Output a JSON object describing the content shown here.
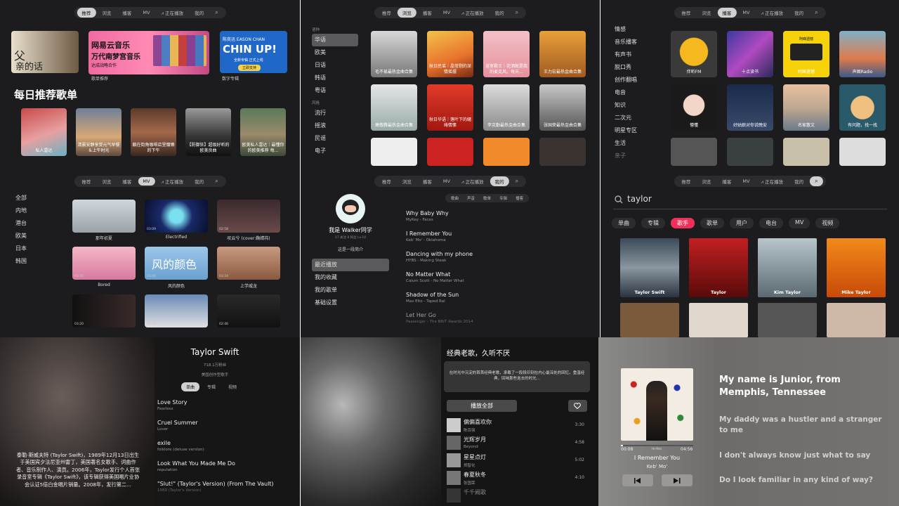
{
  "nav": {
    "rec": "推荐",
    "browse": "浏览",
    "podcast": "播客",
    "mv": "MV",
    "playing": "⩘ 正在播放",
    "mine": "我的",
    "search": "⌕"
  },
  "p1": {
    "banner1_l1": "父",
    "banner1_l2": "亲的话",
    "banner2_title": "网易云音乐",
    "banner2_sub": "万代南梦宫音乐",
    "banner2_sub2": "达成战略合作",
    "banner2_tag": "歌单推荐",
    "banner3_t1": "陈奕迅 EASON CHAN",
    "banner3_big": "CHIN UP!",
    "banner3_t2": "全新专辑 正式上线",
    "banner3_btn": "立即支持",
    "banner3_tag": "数字专辑",
    "section": "每日推荐歌单",
    "tiles": [
      "私人雷达",
      "清晨安静享受元气早餐＆上午时光",
      "躺在街角咖啡店里慵懒的下午",
      "【防御狂】超级好听的欧美良曲",
      "欧美私人雷达｜最懂你的欧美推荐 每..."
    ]
  },
  "p2": {
    "h1": "语种",
    "langs": [
      "华语",
      "欧美",
      "日语",
      "韩语",
      "粤语"
    ],
    "h2": "风格",
    "styles": [
      "流行",
      "摇滚",
      "民谣",
      "电子"
    ],
    "tiles": [
      "毛不易最热金曲合集",
      "秋日民谣｜晶莹剔的深情摇摆",
      "浴室歌王｜花洒就是我的麦克风，每天...",
      "王力宏最热金曲合集",
      "萧敬腾最热金曲合集",
      "秋日华语｜落叶下的缱绻情愫",
      "李克勤最热金曲合集",
      "张国荣最热金曲合集"
    ]
  },
  "p3": {
    "cats": [
      "情感",
      "音乐播客",
      "有声书",
      "脱口秀",
      "创作翻唱",
      "电音",
      "知识",
      "二次元",
      "明星专区",
      "生活",
      "亲子"
    ],
    "tiles": [
      "伴听FM",
      "十点读书",
      "阿峰遗憾",
      "声图Radio",
      "懵懂",
      "好姑娘对你说晚安",
      "名家散文",
      "有问题，找一找"
    ],
    "t3_tag": "阿峰遗憾"
  },
  "p4": {
    "regions": [
      "全部",
      "内地",
      "港台",
      "欧美",
      "日本",
      "韩国"
    ],
    "tiles": [
      "那年初夏",
      "Electrified",
      "叹云兮 (cover:鞠婧祎)",
      "Bored",
      "风的颜色",
      "上学威龙"
    ],
    "durs": [
      "03:10",
      "03:09",
      "02:58",
      "03:41",
      "03:06",
      "03:24",
      "03:20",
      "02:36",
      "02:46"
    ],
    "t5_art": "风的颜色"
  },
  "p5": {
    "user": "我是 Walker同学",
    "stats": "17 关注  8 粉丝  Lv.10",
    "bio": "这是一段简介",
    "menu": [
      "最近播放",
      "我的收藏",
      "我的歌单",
      "基础设置"
    ],
    "tabs": [
      "歌曲",
      "声音",
      "歌单",
      "专辑",
      "播客"
    ],
    "songs": [
      {
        "t": "Why Baby Why",
        "s": "MyKey - Faces"
      },
      {
        "t": "I Remember You",
        "s": "Keb' Mo' - Oklahoma"
      },
      {
        "t": "Dancing with my phone",
        "s": "HYBS - Making Steak"
      },
      {
        "t": "No Matter What",
        "s": "Calum Scott - No Matter What"
      },
      {
        "t": "Shadow of the Sun",
        "s": "Max Elto - Taped Rai"
      },
      {
        "t": "Let Her Go",
        "s": "Passenger - The BRIT Awards 2014"
      }
    ]
  },
  "p6": {
    "query": "taylor",
    "tabs": [
      "单曲",
      "专辑",
      "歌手",
      "歌单",
      "用户",
      "电台",
      "MV",
      "视频"
    ],
    "artists": [
      "Taylor Swift",
      "Taylor",
      "Kim Taylor",
      "Mike Taylor"
    ]
  },
  "p7": {
    "name": "Taylor Swift",
    "fans": "718.1万粉丝",
    "desc": "美国创作型歌手",
    "tabs": [
      "单曲",
      "专辑",
      "视频"
    ],
    "bio": "泰勒·斯威夫特 (Taylor Swift)，1989年12月13日出生于美国宾夕法尼亚州雷丁，美国著名女歌手、词曲作者、音乐制作人、演员。2006年，Taylor发行个人首张录音室专辑《Taylor Swift》，该专辑获得美国唱片业协会认证5倍白金唱片销量。2008年，发行第二...",
    "songs": [
      {
        "t": "Love Story",
        "s": "Fearless"
      },
      {
        "t": "Cruel Summer",
        "s": "Lover"
      },
      {
        "t": "exile",
        "s": "folklore (deluxe version)"
      },
      {
        "t": "Look What You Made Me Do",
        "s": "reputation"
      },
      {
        "t": "\"Slut!\" (Taylor's Version) (From The Vault)",
        "s": "1989 (Taylor's Version)"
      }
    ]
  },
  "p8": {
    "title": "经典老歌，久听不厌",
    "desc": "在时光中沉淀的首首经典老歌，承载了一段段印刻在内心最深处的回忆。重温经典，回味那些逝去的时光...",
    "play_all": "播放全部",
    "songs": [
      {
        "t": "偏偏喜欢你",
        "a": "陈百强",
        "d": "3:30"
      },
      {
        "t": "光辉岁月",
        "a": "Beyond",
        "d": "4:58"
      },
      {
        "t": "星星点灯",
        "a": "郑智化",
        "d": "5:02"
      },
      {
        "t": "春夏秋冬",
        "a": "张国荣",
        "d": "4:10"
      },
      {
        "t": "千千阙歌",
        "a": "",
        "d": ""
      }
    ]
  },
  "p9": {
    "elapsed": "00:08",
    "total": "04:56",
    "song": "I Remember You",
    "artist": "Keb' Mo'",
    "lyrics": [
      "My name is Junior, from Memphis, Tennessee",
      "My daddy was a hustler and a stranger to me",
      "I don't always know just what to say",
      "Do I look familiar in any kind of way?"
    ],
    "progress": 0.03
  }
}
